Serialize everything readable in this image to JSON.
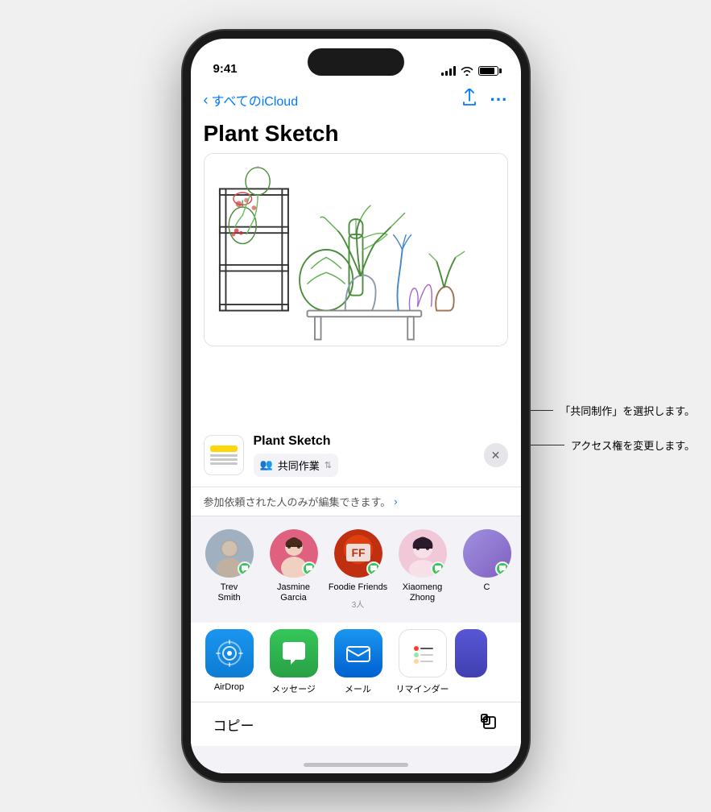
{
  "status_bar": {
    "time": "9:41",
    "signal": "●●●●",
    "wifi": "wifi",
    "battery": "battery"
  },
  "nav": {
    "back_label": "すべてのiCloud",
    "share_icon": "↑",
    "more_icon": "···"
  },
  "page": {
    "title": "Plant Sketch"
  },
  "share_sheet": {
    "filename": "Plant Sketch",
    "collab_label": "共同作業",
    "access_label": "参加依頼された人のみが編集できます。",
    "access_chevron": ">",
    "close_icon": "✕"
  },
  "contacts": [
    {
      "name": "Trev\nSmith",
      "type": "avatar-trev"
    },
    {
      "name": "Jasmine\nGarcia",
      "type": "avatar-jasmine"
    },
    {
      "name": "Foodie Friends",
      "sub": "3人",
      "type": "avatar-foodie"
    },
    {
      "name": "Xiaomeng\nZhong",
      "type": "avatar-xiaomeng"
    }
  ],
  "apps": [
    {
      "label": "AirDrop",
      "type": "airdrop"
    },
    {
      "label": "メッセージ",
      "type": "messages"
    },
    {
      "label": "メール",
      "type": "mail"
    },
    {
      "label": "リマインダー",
      "type": "reminders"
    }
  ],
  "bottom": {
    "copy_label": "コピー"
  },
  "annotations": [
    "「共同制作」を選択します。",
    "アクセス権を変更します。"
  ]
}
